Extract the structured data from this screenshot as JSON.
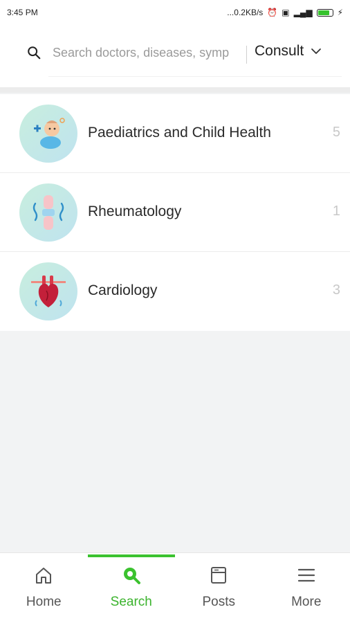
{
  "status_bar": {
    "time": "3:45 PM",
    "network_speed": "...0.2KB/s"
  },
  "search": {
    "placeholder": "Search doctors, diseases, symp",
    "consult_label": "Consult"
  },
  "specialties": [
    {
      "name": "Paediatrics and Child Health",
      "count": "5",
      "icon": "baby-icon"
    },
    {
      "name": "Rheumatology",
      "count": "1",
      "icon": "joint-icon"
    },
    {
      "name": "Cardiology",
      "count": "3",
      "icon": "heart-icon"
    }
  ],
  "bottom_nav": {
    "items": [
      {
        "label": "Home",
        "icon": "home-icon"
      },
      {
        "label": "Search",
        "icon": "search-icon",
        "active": true
      },
      {
        "label": "Posts",
        "icon": "posts-icon"
      },
      {
        "label": "More",
        "icon": "menu-icon"
      }
    ]
  },
  "colors": {
    "accent": "#3bc22f",
    "avatar_bg": "#c8eede"
  }
}
